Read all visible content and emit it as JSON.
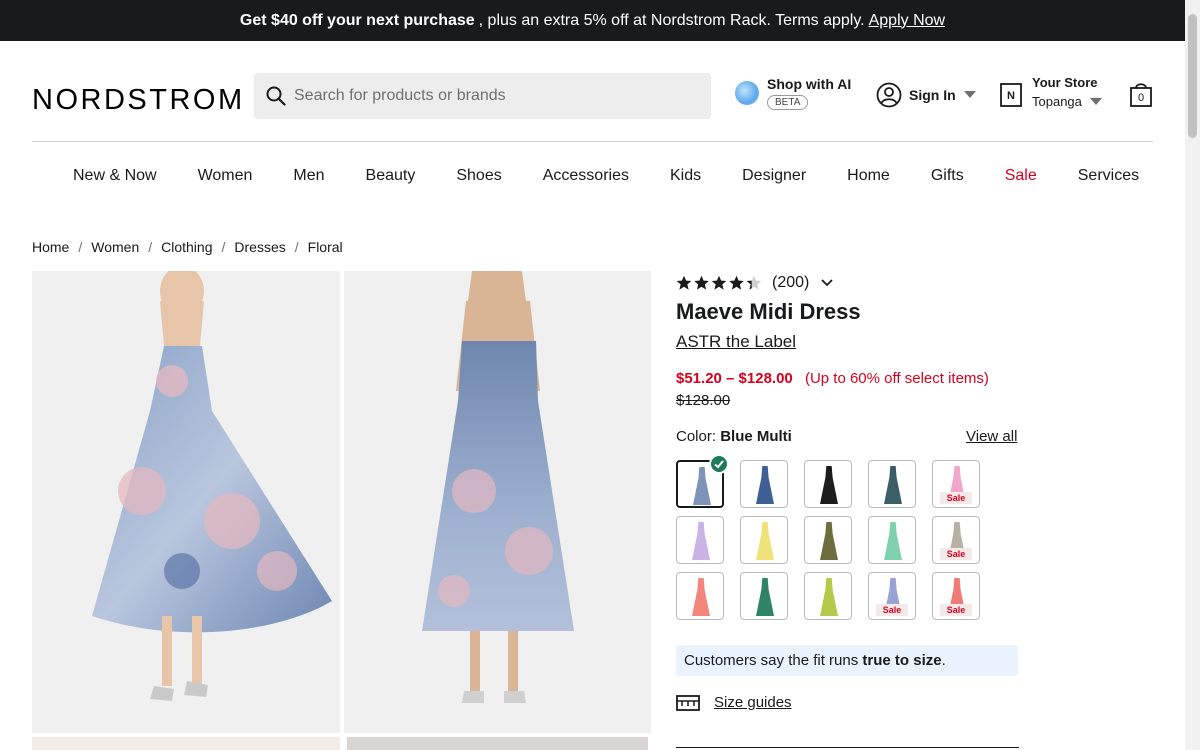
{
  "promo": {
    "bold": "Get $40 off your next purchase",
    "rest": ", plus an extra 5% off at Nordstrom Rack. Terms apply.",
    "link": "Apply Now"
  },
  "header": {
    "logo": "NORDSTROM",
    "search_placeholder": "Search for products or brands",
    "ai_label": "Shop with AI",
    "ai_badge": "BETA",
    "signin": "Sign In",
    "store_title": "Your Store",
    "store_name": "Topanga",
    "bag_count": "0"
  },
  "nav": [
    "New & Now",
    "Women",
    "Men",
    "Beauty",
    "Shoes",
    "Accessories",
    "Kids",
    "Designer",
    "Home",
    "Gifts",
    "Sale",
    "Services"
  ],
  "breadcrumbs": [
    "Home",
    "Women",
    "Clothing",
    "Dresses",
    "Floral"
  ],
  "product": {
    "rating": 4.4,
    "review_count": "(200)",
    "title": "Maeve Midi Dress",
    "brand": "ASTR the Label",
    "price_range": "$51.20 – $128.00",
    "discount": "(Up to 60% off select items)",
    "original_price": "$128.00",
    "color_label": "Color:",
    "color_value": "Blue Multi",
    "view_all": "View all",
    "fit_prefix": "Customers say the fit runs",
    "fit_bold": "true to size",
    "fit_suffix": ".",
    "size_guides": "Size guides",
    "sale_badge": "Sale"
  },
  "swatches": [
    {
      "color": "#7d93b8",
      "sale": false,
      "selected": true
    },
    {
      "color": "#3d5f94",
      "sale": false
    },
    {
      "color": "#1d1d1d",
      "sale": false
    },
    {
      "color": "#3a5d66",
      "sale": false
    },
    {
      "color": "#f0a7c9",
      "sale": true
    },
    {
      "color": "#c9b3e6",
      "sale": false
    },
    {
      "color": "#f0e27a",
      "sale": false
    },
    {
      "color": "#6e6d3f",
      "sale": false
    },
    {
      "color": "#7fd1ad",
      "sale": false
    },
    {
      "color": "#b7b0a3",
      "sale": true
    },
    {
      "color": "#f2867d",
      "sale": false
    },
    {
      "color": "#2e8465",
      "sale": false
    },
    {
      "color": "#b5c948",
      "sale": false
    },
    {
      "color": "#9aa4d4",
      "sale": true
    },
    {
      "color": "#ef7b76",
      "sale": true
    }
  ],
  "colors": {
    "sale_red": "#d6001c",
    "promo_bg": "#191a1b"
  }
}
